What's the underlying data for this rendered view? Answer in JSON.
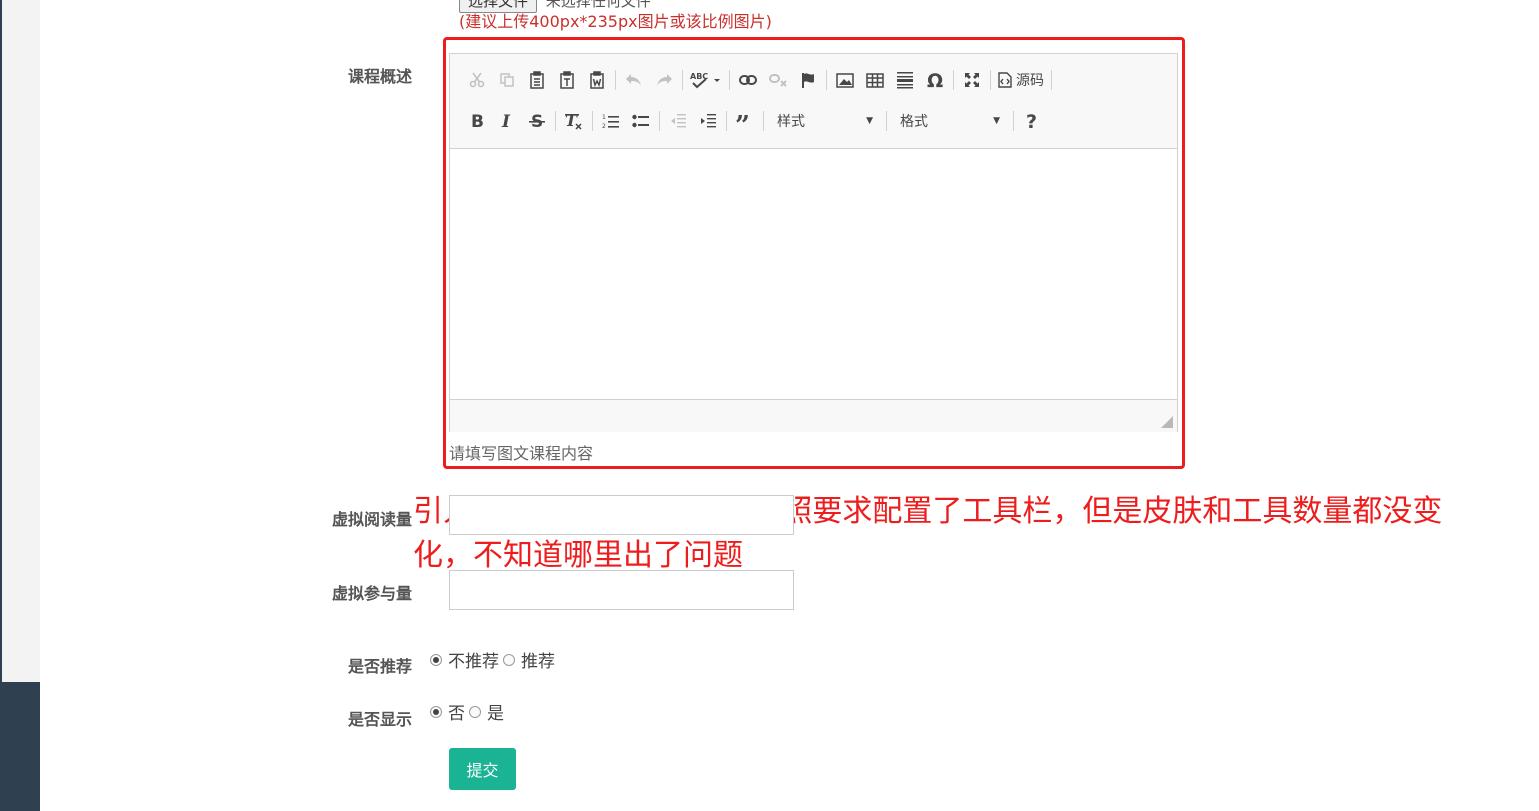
{
  "cover_upload": {
    "choose_button": "选择文件",
    "file_status": "未选择任何文件",
    "hint": "(建议上传400px*235px图片或该比例图片)"
  },
  "course_summary": {
    "label": "课程概述",
    "editor_hint": "请填写图文课程内容",
    "toolbar": {
      "source_label": "源码",
      "styles_label": "样式",
      "format_label": "格式"
    }
  },
  "annotation": "引入的CKEditor编辑器，按照要求配置了工具栏，但是皮肤和工具数量都没变化，不知道哪里出了问题",
  "virtual_reads": {
    "label": "虚拟阅读量",
    "value": ""
  },
  "virtual_participants": {
    "label": "虚拟参与量",
    "value": ""
  },
  "recommend": {
    "label": "是否推荐",
    "options": [
      "不推荐",
      "推荐"
    ],
    "selected": "不推荐"
  },
  "display": {
    "label": "是否显示",
    "options": [
      "否",
      "是"
    ],
    "selected": "否"
  },
  "submit_label": "提交",
  "colors": {
    "accent": "#1ab394",
    "annotation_red": "#ee1d1d",
    "sidebar_dark": "#2f4050"
  }
}
